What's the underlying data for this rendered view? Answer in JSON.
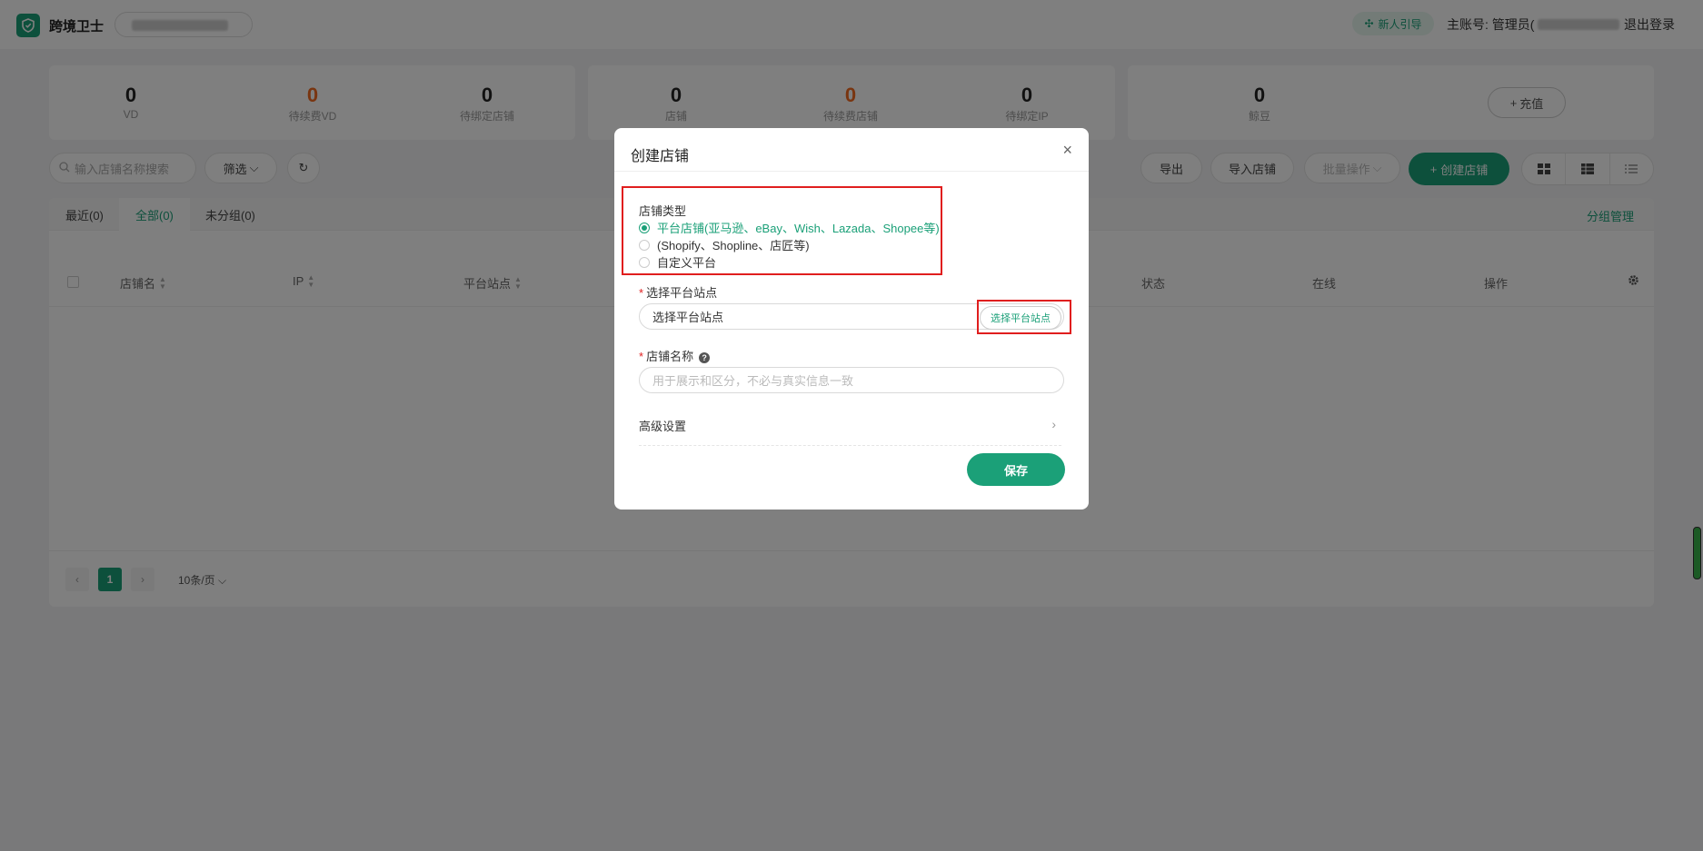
{
  "header": {
    "app_name": "跨境卫士",
    "guide_label": "新人引导",
    "main_account_label": "主账号: 管理员(",
    "logout_label": "退出登录"
  },
  "stats": {
    "card1": [
      {
        "value": "0",
        "label": "VD"
      },
      {
        "value": "0",
        "label": "待续费VD"
      },
      {
        "value": "0",
        "label": "待绑定店铺"
      }
    ],
    "card2": [
      {
        "value": "0",
        "label": "店铺"
      },
      {
        "value": "0",
        "label": "待续费店铺"
      },
      {
        "value": "0",
        "label": "待绑定IP"
      }
    ],
    "card3": [
      {
        "value": "0",
        "label": "鲸豆"
      }
    ],
    "recharge_label": "充值"
  },
  "toolbar": {
    "search_placeholder": "输入店铺名称搜索",
    "filter_label": "筛选",
    "export_label": "导出",
    "import_label": "导入店铺",
    "batch_label": "批量操作",
    "create_label": "创建店铺"
  },
  "tabs": [
    {
      "label": "最近(0)"
    },
    {
      "label": "全部(0)"
    },
    {
      "label": "未分组(0)"
    }
  ],
  "group_mgmt_label": "分组管理",
  "table": {
    "columns": [
      "店铺名",
      "IP",
      "平台站点",
      "状态",
      "在线",
      "操作"
    ]
  },
  "pager": {
    "current_page": "1",
    "page_size": "10条/页"
  },
  "modal": {
    "title": "创建店铺",
    "store_type_label": "店铺类型",
    "store_types": [
      {
        "label": "平台店铺(亚马逊、eBay、Wish、Lazada、Shopee等)",
        "selected": true
      },
      {
        "label": "(Shopify、Shopline、店匠等)",
        "selected": false
      },
      {
        "label": "自定义平台",
        "selected": false
      }
    ],
    "site_label": "选择平台站点",
    "site_value": "选择平台站点",
    "site_button": "选择平台站点",
    "name_label": "店铺名称",
    "name_placeholder": "用于展示和区分，不必与真实信息一致",
    "advanced_label": "高级设置",
    "save_label": "保存"
  },
  "colors": {
    "brand": "#1ba078",
    "warning": "#f26a21",
    "highlight": "#e01e1e"
  }
}
